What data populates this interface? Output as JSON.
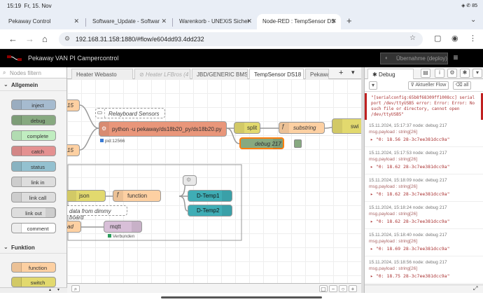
{
  "status": {
    "time": "15:19",
    "date": "Fr, 15. Nov",
    "icons": "◈ ✆ 85"
  },
  "browser_tabs": [
    {
      "title": "Pekaway Control"
    },
    {
      "title": "Software_Update - Softwar"
    },
    {
      "title": "Warenkorb - UNEXiS Sicher"
    },
    {
      "title": "Node-RED : TempSensor DS"
    }
  ],
  "address": {
    "url": "192.168.31.158:1880/#flow/e604dd93.4dd232"
  },
  "nr": {
    "title": "Pekaway VAN PI Campercontrol",
    "deploy": "Übernahme (deploy)"
  },
  "palette": {
    "filter_placeholder": "Nodes filtern",
    "cat1": "Allgemein",
    "cat2": "Funktion",
    "nodes1": [
      "inject",
      "debug",
      "complete",
      "catch",
      "status",
      "link in",
      "link call",
      "link out",
      "comment"
    ],
    "nodes2": [
      "function",
      "switch"
    ]
  },
  "workspace_tabs": [
    "Heater Webasto",
    "Heater LFBros (4",
    "JBD/GENERIC BMS",
    "TempSensor DS18",
    "Pekaway"
  ],
  "canvas": {
    "comment1": "Relayboard Sensors",
    "exec": "python -u pekaway/ds18b20_py/ds18b20.py",
    "exec_status": "pid:12566",
    "split": "split",
    "substring": "substring",
    "switch": "swi",
    "debug": "debug 217",
    "json": "json",
    "function": "function",
    "dtemp1": "D-Temp1",
    "dtemp2": "D-Temp2",
    "comment2": "data from dimmy board",
    "mqtt_in": "ad",
    "mqtt": "mqtt",
    "mqtt_status": "Verbunden",
    "num1": "15",
    "num2": "15"
  },
  "sidebar": {
    "title": "Debug",
    "filter": "Aktueller Flow",
    "clear": "all",
    "error": "\"[serialconfig:65b8f68309ff1008cc] serial port /dev/ttyUSB5 error: Error: Error: No such file or directory, cannot open /dev/ttyUSB5\"",
    "messages": [
      {
        "meta": "15.11.2024, 15:17:37  node: debug 217",
        "topic": "msg.payload : string[26]",
        "val": "\"0:  18.56 28-3c7ee381dcc9a\""
      },
      {
        "meta": "15.11.2024, 15:17:53  node: debug 217",
        "topic": "msg.payload : string[26]",
        "val": "\"0:  18.62 28-3c7ee381dcc9a\""
      },
      {
        "meta": "15.11.2024, 15:18:09  node: debug 217",
        "topic": "msg.payload : string[26]",
        "val": "\"0:  18.62 28-3c7ee381dcc9a\""
      },
      {
        "meta": "15.11.2024, 15:18:24  node: debug 217",
        "topic": "msg.payload : string[26]",
        "val": "\"0:  18.62 28-3c7ee381dcc9a\""
      },
      {
        "meta": "15.11.2024, 15:18:40  node: debug 217",
        "topic": "msg.payload : string[26]",
        "val": "\"0:  18.69 28-3c7ee381dcc9a\""
      },
      {
        "meta": "15.11.2024, 15:18:56  node: debug 217",
        "topic": "msg.payload : string[26]",
        "val": "\"0:  18.75 28-3c7ee381dcc9a\""
      }
    ]
  }
}
